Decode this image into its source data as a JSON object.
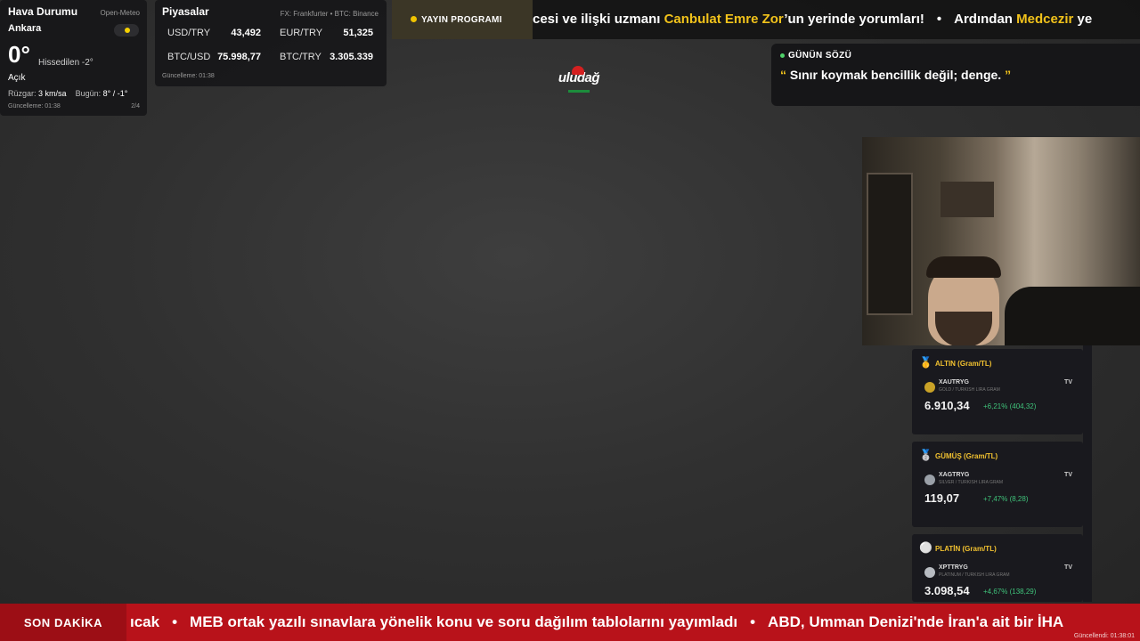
{
  "weather": {
    "title": "Hava Durumu",
    "source": "Open-Meteo",
    "city": "Ankara",
    "temp": "0°",
    "feels": "Hissedilen -2°",
    "condition": "Açık",
    "wind_label": "Rüzgar:",
    "wind": "3 km/sa",
    "today_label": "Bugün:",
    "today": "8° / -1°",
    "updated": "Güncelleme: 01:38",
    "page": "2/4"
  },
  "markets": {
    "title": "Piyasalar",
    "source": "FX: Frankfurter • BTC: Binance",
    "items": [
      {
        "label": "USD/TRY",
        "value": "43,492"
      },
      {
        "label": "EUR/TRY",
        "value": "51,325"
      },
      {
        "label": "BTC/USD",
        "value": "75.998,77"
      },
      {
        "label": "BTC/TRY",
        "value": "3.305.339"
      }
    ],
    "updated": "Güncelleme: 01:38"
  },
  "top_ticker": {
    "program_label": "YAYIN PROGRAMI",
    "part1": "cesi ve ilişki uzmanı ",
    "highlight1": "Canbulat Emre Zor",
    "part2": "’un yerinde yorumları!",
    "separator": "•",
    "part3": "Ardından ",
    "highlight2": "Medcezir",
    "part4": " ye"
  },
  "logo": {
    "text": "uludağ"
  },
  "quote": {
    "title": "GÜNÜN SÖZÜ",
    "open_mark": "“",
    "text": " Sınır koymak bencillik değil; denge. ",
    "close_mark": "”"
  },
  "metals": [
    {
      "icon": "medal-gold-icon",
      "icon_char": "🥇",
      "title": "ALTIN (Gram/TL)",
      "symbol": "XAUTRYG",
      "subtitle": "GOLD / TURKISH LIRA GRAM",
      "price": "6.910,34",
      "change": "+6,21% (404,32)",
      "color": "#c9a227"
    },
    {
      "icon": "medal-silver-icon",
      "icon_char": "🥈",
      "title": "GÜMÜŞ (Gram/TL)",
      "symbol": "XAGTRYG",
      "subtitle": "SILVER / TURKISH LIRA GRAM",
      "price": "119,07",
      "change": "+7,47% (8,28)",
      "color": "#9aa0a8"
    },
    {
      "icon": "platinum-circle-icon",
      "icon_char": "⚪",
      "title": "PLATİN (Gram/TL)",
      "symbol": "XPTTRYG",
      "subtitle": "PLATINUM / TURKISH LIRA GRAM",
      "price": "3.098,54",
      "change": "+4,67% (138,29)",
      "color": "#b8bcc2"
    }
  ],
  "tradingview_mark": "TV",
  "bottom_ticker": {
    "label": "SON DAKİKA",
    "item0": "ıcak",
    "separator": "•",
    "item1": "MEB ortak yazılı sınavlara yönelik konu ve soru dağılım tablolarını yayımladı",
    "item2": "ABD, Umman Denizi'nde İran'a ait bir İHA",
    "updated": "Güncellendi: 01:38:01"
  }
}
